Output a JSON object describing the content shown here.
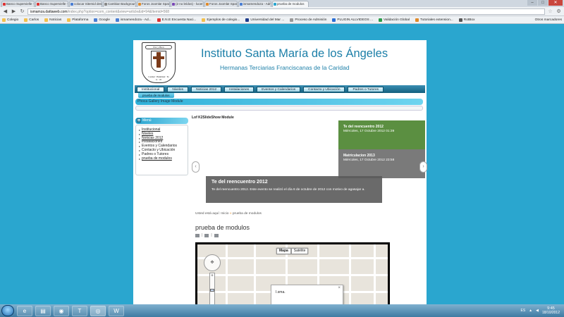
{
  "browser": {
    "tabs": [
      {
        "label": "Banco Supervielle - Banco",
        "color": "#d33"
      },
      {
        "label": "Banco Supervielle - IC - Ba",
        "color": "#d33"
      },
      {
        "label": "colocar Sitemid desde mo",
        "color": "#4a7fd4"
      },
      {
        "label": "Cambiar Background de m",
        "color": "#888"
      },
      {
        "label": "Foros Joomla! Spanish - Tu",
        "color": "#e08a2a"
      },
      {
        "label": "(2 no leídos) - lucero_carlo",
        "color": "#7b4ab5"
      },
      {
        "label": "Foros Joomla! Spanish - Tu",
        "color": "#e08a2a"
      },
      {
        "label": "ismamendoza - Administr",
        "color": "#4a7fd4"
      },
      {
        "label": "prueba de modulos",
        "color": "#2aa6cf",
        "active": true
      }
    ],
    "window_controls": {
      "minimize": "–",
      "maximize": "□",
      "close": "✕"
    },
    "url_host": "ismamza.dattaweb.com",
    "url_path": "/index.php?option=com_content&view=article&id=94&Itemid=568",
    "bookmarks": [
      {
        "label": "Colegio",
        "color": "#f2c14e"
      },
      {
        "label": "Carlos",
        "color": "#f2c14e"
      },
      {
        "label": "Noticias",
        "color": "#f2c14e"
      },
      {
        "label": "Plataforma",
        "color": "#f2c14e"
      },
      {
        "label": "Google",
        "color": "#4a7fd4"
      },
      {
        "label": "ismamendoza - Ad...",
        "color": "#4a7fd4"
      },
      {
        "label": "E.N.E Encuesta Naci...",
        "color": "#d33"
      },
      {
        "label": "Ejemplos de colegio...",
        "color": "#f2c14e"
      },
      {
        "label": "Universidad del Mar ...",
        "color": "#1e3c8c"
      },
      {
        "label": "Proceso de Admisión",
        "color": "#999"
      },
      {
        "label": "PLUGIN ALLVIDEOS ...",
        "color": "#2a6ed4"
      },
      {
        "label": "Validación Global",
        "color": "#2a9d4a"
      },
      {
        "label": "Tutoriales extension...",
        "color": "#e08a2a"
      },
      {
        "label": "RotBox",
        "color": "#555"
      }
    ],
    "other_bookmarks": "Otros marcadores"
  },
  "site": {
    "logo_ribbon": "Paz y Bien",
    "logo_motto": "Caridad · Humildad · Fe",
    "logo_year": "11 · 05",
    "title": "Instituto Santa María de los Ángeles",
    "subtitle": "Hermanas Terciarias Franciscanas de la Caridad",
    "nav": [
      "Institucional",
      "Niveles",
      "Noticias 2012",
      "Instalaciones",
      "Eventos y Calendarios",
      "Contacto y Ubicación",
      "Padres o Tutores"
    ],
    "subnav": "prueba de modulos",
    "gallery_module": "Phoca Gallery Image Module"
  },
  "sidebar": {
    "heading": "Menú",
    "items": [
      {
        "label": "Institucional",
        "link": true
      },
      {
        "label": "Niveles",
        "link": true
      },
      {
        "label": "Noticias 2012",
        "link": true
      },
      {
        "label": "Instalaciones",
        "link": false
      },
      {
        "label": "Eventos y Calendarios",
        "link": false
      },
      {
        "label": "Contacto y Ubicación",
        "link": false
      },
      {
        "label": "Padres o Tutores",
        "link": false
      },
      {
        "label": "prueba de modulos",
        "link": true
      }
    ]
  },
  "slideshow": {
    "module_title": "Lof K2SlideShow Module",
    "prev": "‹",
    "next": "›",
    "main_title": "Te del reencuentro 2012",
    "main_desc": "Te del reencuentro 2012. Este evento se realizó el día 6 de octubre de 2012 con motivo de agasajar a.",
    "thumbs": [
      {
        "title": "Te del reencuentro 2012",
        "date": "Miércoles, 17 Octubre 2012 01:39"
      },
      {
        "title": "Matriculacion 2013",
        "date": "Miércoles, 17 Octubre 2012 23:58"
      }
    ]
  },
  "content": {
    "breadcrumb_prefix": "Usted está aquí:",
    "breadcrumb_home": "Inicio",
    "breadcrumb_sep": "»",
    "breadcrumb_current": "prueba de modulos",
    "page_title": "prueba de modulos",
    "icon_sep": "|"
  },
  "map": {
    "type_map": "Mapa",
    "type_satellite": "Satélite",
    "zoom_plus": "+",
    "zoom_minus": "−",
    "pan_symbol": "✥",
    "info_text": "I.sma.",
    "info_close": "×"
  },
  "taskbar": {
    "apps": [
      "e",
      "▤",
      "◉",
      "T",
      "◎",
      "W"
    ],
    "lang": "ES",
    "time": "9:45",
    "date": "18/10/2012"
  }
}
